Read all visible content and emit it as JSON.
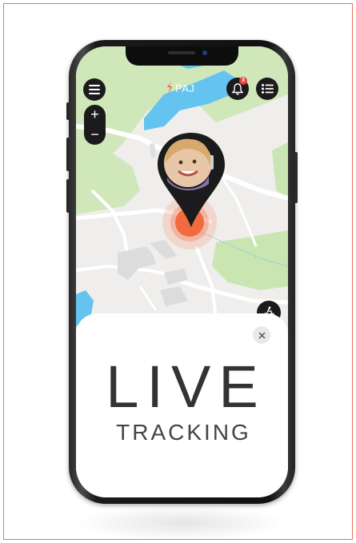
{
  "app": {
    "logo_text": "PAJ",
    "notification_count": "3"
  },
  "map_controls": {
    "zoom_in_label": "+",
    "zoom_out_label": "−"
  },
  "panel": {
    "title": "LIVE",
    "subtitle": "TRACKING",
    "close_label": "×"
  },
  "colors": {
    "accent": "#e8775a",
    "pin_dark": "#1b1b1b",
    "location_ring": "#f26b3e",
    "water": "#64c3ef",
    "park": "#c9e6b2"
  },
  "icons": [
    "menu-icon",
    "bell-icon",
    "list-icon",
    "bike-icon",
    "close-icon",
    "location-pin-icon"
  ]
}
